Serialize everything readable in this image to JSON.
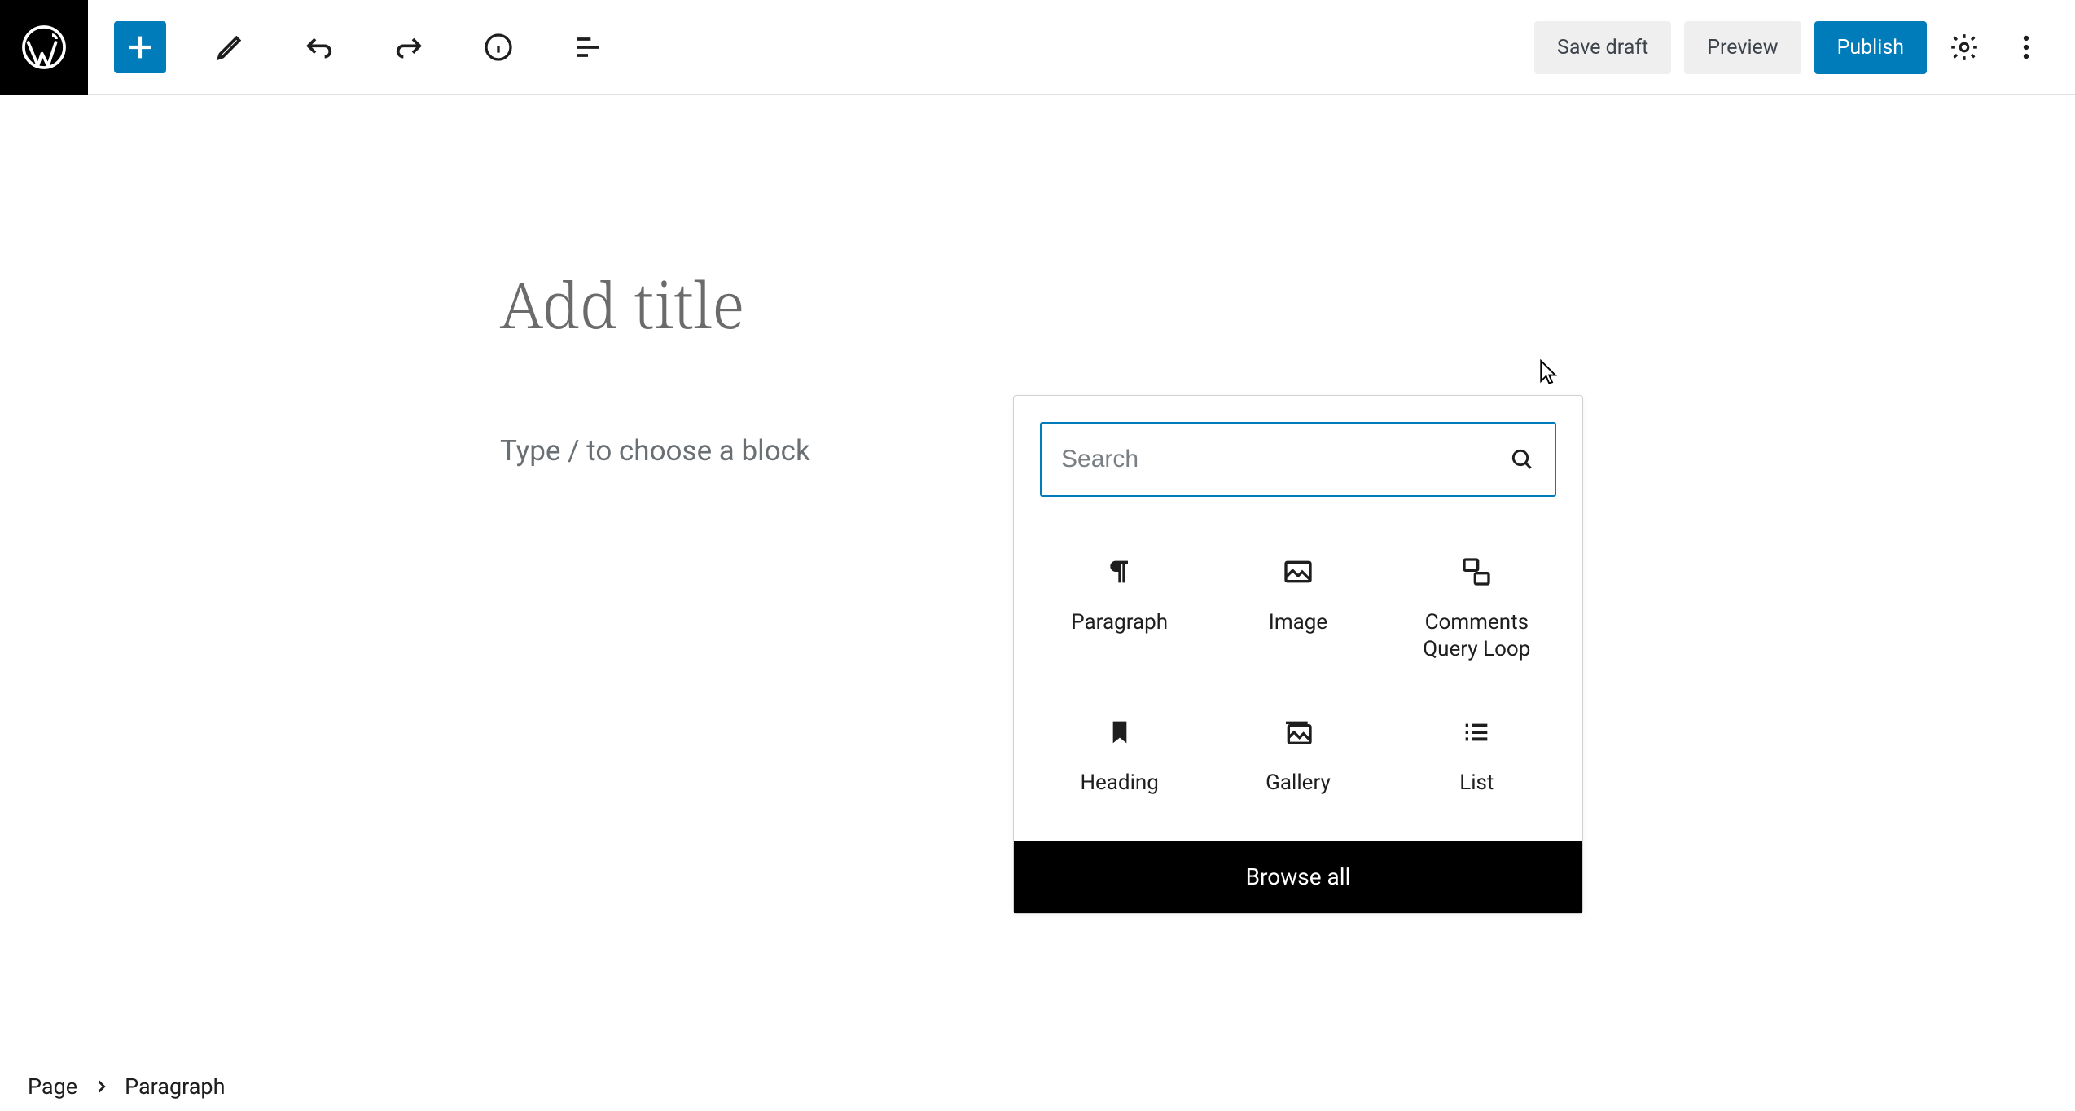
{
  "toolbar": {
    "save_draft": "Save draft",
    "preview": "Preview",
    "publish": "Publish"
  },
  "editor": {
    "title_placeholder": "Add title",
    "paragraph_placeholder": "Type / to choose a block"
  },
  "inserter": {
    "search_placeholder": "Search",
    "blocks": [
      {
        "label": "Paragraph",
        "icon": "paragraph"
      },
      {
        "label": "Image",
        "icon": "image"
      },
      {
        "label": "Comments\nQuery Loop",
        "icon": "comments-query"
      },
      {
        "label": "Heading",
        "icon": "bookmark"
      },
      {
        "label": "Gallery",
        "icon": "gallery"
      },
      {
        "label": "List",
        "icon": "list"
      }
    ],
    "browse_all": "Browse all"
  },
  "breadcrumb": {
    "root": "Page",
    "current": "Paragraph"
  },
  "colors": {
    "accent": "#007cba",
    "black": "#000000"
  }
}
